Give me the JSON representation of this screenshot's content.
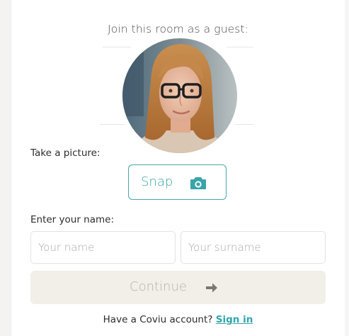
{
  "header": {
    "title": "Join this room as a guest:"
  },
  "photo": {
    "take_picture_label": "Take a picture:",
    "snap_label": "Snap",
    "snap_icon": "camera-icon"
  },
  "name": {
    "label": "Enter your name:",
    "first_name_placeholder": "Your name",
    "first_name_value": "",
    "surname_placeholder": "Your surname",
    "surname_value": ""
  },
  "actions": {
    "continue_label": "Continue",
    "continue_icon": "arrow-right-icon"
  },
  "footer": {
    "prompt": "Have a Coviu account?",
    "signin_label": "Sign in"
  },
  "colors": {
    "accent": "#3aa4a8",
    "disabled_button_bg": "#f1efe8",
    "disabled_button_text": "#b4b2ab"
  }
}
